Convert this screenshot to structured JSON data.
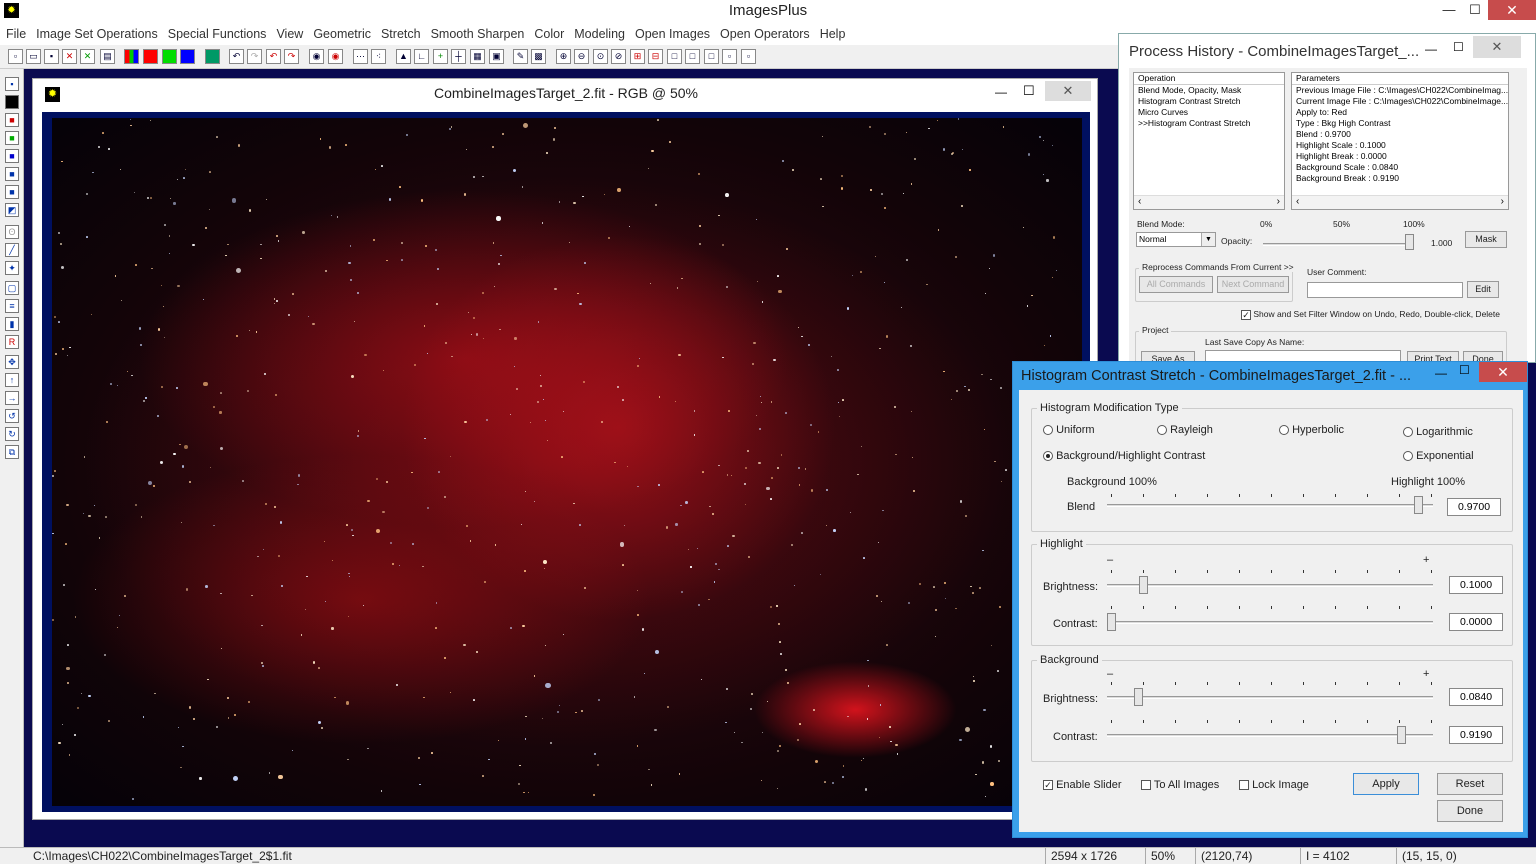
{
  "app": {
    "title": "ImagesPlus",
    "icon": "app-icon"
  },
  "menu": [
    "File",
    "Image Set Operations",
    "Special Functions",
    "View",
    "Geometric",
    "Stretch",
    "Smooth Sharpen",
    "Color",
    "Modeling",
    "Open Images",
    "Open Operators",
    "Help"
  ],
  "image_window": {
    "title": "CombineImagesTarget_2.fit - RGB @ 50%"
  },
  "status": {
    "path": "C:\\Images\\CH022\\CombineImagesTarget_2$1.fit",
    "size": "2594 x 1726",
    "zoom": "50%",
    "coords": "(2120,74)",
    "intensity": "I = 4102",
    "rgb": "(15, 15, 0)"
  },
  "process_history": {
    "title": "Process History - CombineImagesTarget_...",
    "operation_header": "Operation",
    "operations": [
      "Blend Mode, Opacity, Mask",
      "Histogram Contrast Stretch",
      "Micro Curves",
      ">>Histogram Contrast Stretch"
    ],
    "parameters_header": "Parameters",
    "parameters": [
      "Previous Image File : C:\\Images\\CH022\\CombineImag...",
      "Current Image File : C:\\Images\\CH022\\CombineImage...",
      "Apply to:  Red",
      "Type : Bkg High Contrast",
      "Blend : 0.9700",
      "Highlight Scale : 0.1000",
      "Highlight Break : 0.0000",
      "Background Scale : 0.0840",
      "Background Break : 0.9190"
    ],
    "blend_mode_label": "Blend Mode:",
    "blend_mode_value": "Normal",
    "opacity_label": "Opacity:",
    "opacity_ticks": [
      "0%",
      "50%",
      "100%"
    ],
    "opacity_value": "1.000",
    "opacity_level": 1.0,
    "mask_label": "Mask",
    "reprocess_label": "Reprocess Commands From Current >>",
    "all_commands": "All Commands",
    "next_command": "Next Command",
    "user_comment_label": "User Comment:",
    "edit_label": "Edit",
    "show_filter_label": "Show and Set Filter Window on Undo, Redo, Double-click, Delete",
    "show_filter_checked": true,
    "project_label": "Project",
    "last_save_label": "Last Save Copy As Name:",
    "save_as_label": "Save As",
    "print_text_label": "Print Text",
    "done_label": "Done"
  },
  "hcs": {
    "title": "Histogram Contrast Stretch - CombineImagesTarget_2.fit - ...",
    "type_group": "Histogram Modification Type",
    "options": [
      {
        "label": "Uniform",
        "selected": false
      },
      {
        "label": "Rayleigh",
        "selected": false
      },
      {
        "label": "Hyperbolic",
        "selected": false
      },
      {
        "label": "Logarithmic",
        "selected": false
      },
      {
        "label": "Background/Highlight Contrast",
        "selected": true
      },
      {
        "label": "Exponential",
        "selected": false
      }
    ],
    "blend_left_label": "Background 100%",
    "blend_right_label": "Highlight 100%",
    "blend_label": "Blend",
    "blend_value": "0.9700",
    "blend_level": 0.97,
    "highlight_group": "Highlight",
    "minus": "–",
    "plus": "+",
    "brightness_label": "Brightness:",
    "contrast_label": "Contrast:",
    "highlight_brightness": "0.1000",
    "highlight_brightness_level": 0.1,
    "highlight_contrast": "0.0000",
    "highlight_contrast_level": 0.0,
    "background_group": "Background",
    "background_brightness": "0.0840",
    "background_brightness_level": 0.084,
    "background_contrast": "0.9190",
    "background_contrast_level": 0.919,
    "enable_slider": "Enable Slider",
    "enable_slider_checked": true,
    "to_all_images": "To All Images",
    "lock_image": "Lock Image",
    "apply": "Apply",
    "reset": "Reset",
    "done": "Done"
  }
}
